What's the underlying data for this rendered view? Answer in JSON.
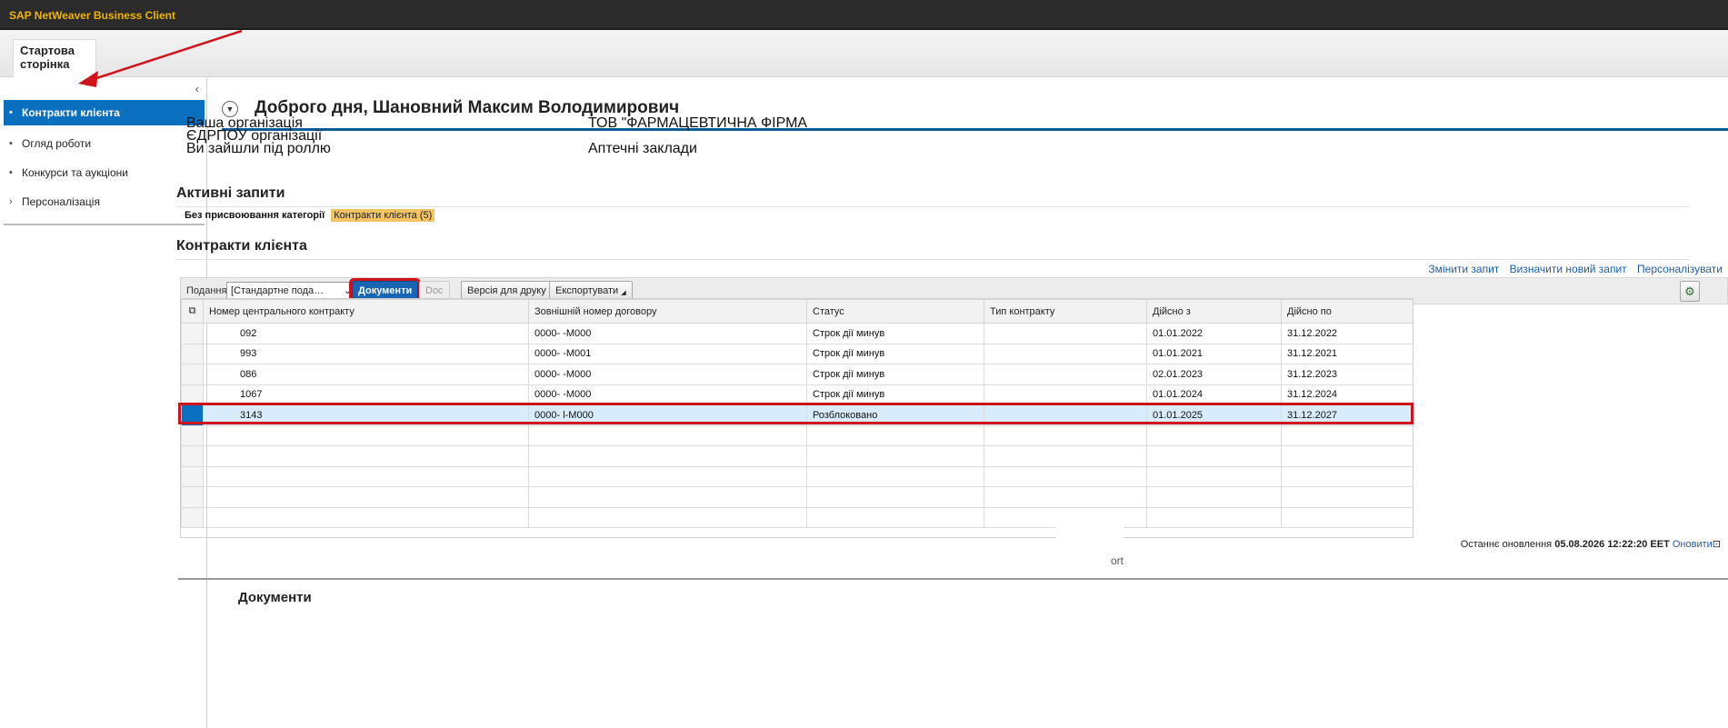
{
  "app": {
    "title": "SAP NetWeaver Business Client"
  },
  "tabs": {
    "home": "Стартова сторінка"
  },
  "sidebar": {
    "items": [
      {
        "label": "Контракти клієнта",
        "active": true,
        "bullet": "•"
      },
      {
        "label": "Огляд роботи",
        "active": false,
        "bullet": "•"
      },
      {
        "label": "Конкурси та аукціони",
        "active": false,
        "bullet": "•"
      },
      {
        "label": "Персоналізація",
        "active": false,
        "bullet": "›"
      }
    ]
  },
  "header": {
    "greeting": "Доброго дня, Шановний Максим Володимирович"
  },
  "info": {
    "org_label": "Ваша організація",
    "edrpou_label": "ЄДРПОУ організації",
    "role_label": "Ви зайшли під роллю",
    "org_value": "ТОВ \"ФАРМАЦЕВТИЧНА ФІРМА",
    "role_value": "Аптечні заклади"
  },
  "active_queries": {
    "title": "Активні запити",
    "category": "Без присвоювання категорії",
    "link": "Контракти клієнта (5)"
  },
  "contracts": {
    "title": "Контракти клієнта",
    "links": [
      "Змінити запит",
      "Визначити новий запит",
      "Персоналізувати"
    ],
    "toolbar": {
      "view_label": "Подання:",
      "view_value": "[Стандартне пода…",
      "documents": "Документи",
      "doc": "Doc",
      "print": "Версія для друку",
      "export": "Експортувати"
    },
    "columns": [
      "Номер центрального контракту",
      "Зовнішній номер договору",
      "Статус",
      "Тип контракту",
      "Дійсно з",
      "Дійсно по"
    ],
    "rows": [
      [
        "092",
        "0000-        -M000",
        "Строк дії минув",
        "",
        "01.01.2022",
        "31.12.2022"
      ],
      [
        "993",
        "0000-        -M001",
        "Строк дії минув",
        "",
        "01.01.2021",
        "31.12.2021"
      ],
      [
        "086",
        "0000-         -M000",
        "Строк дії минув",
        "",
        "02.01.2023",
        "31.12.2023"
      ],
      [
        "1067",
        "0000-       -M000",
        "Строк дії минув",
        "",
        "01.01.2024",
        "31.12.2024"
      ],
      [
        "3143",
        "0000-       l-M000",
        "Розблоковано",
        "",
        "01.01.2025",
        "31.12.2027"
      ]
    ],
    "selected_row": 4,
    "empty_rows": 5,
    "last_update_label": "Останнє оновлення",
    "last_update_value": "05.08.2026 12:22:20 EET",
    "refresh": "Оновити"
  },
  "partial_text": "ort",
  "bottom": {
    "title": "Документи"
  },
  "colors": {
    "accent": "#0b6fbf",
    "highlight": "#d0121b",
    "brand": "#f0b400"
  }
}
